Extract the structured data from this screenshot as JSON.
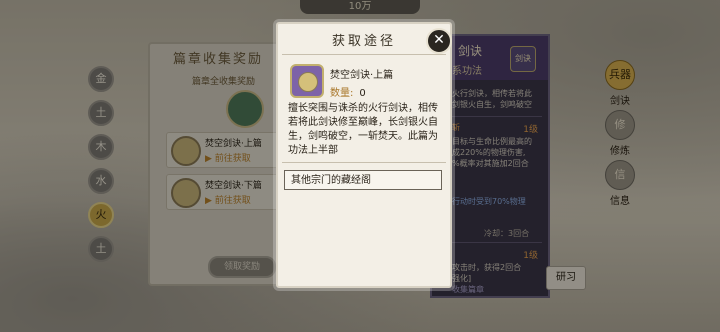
{
  "topbar": {
    "value": "10万"
  },
  "elements": {
    "items": [
      "金",
      "土",
      "木",
      "水",
      "火",
      "土"
    ]
  },
  "left_panel": {
    "title": "篇章收集奖励",
    "reward_label": "篇章全收集奖励",
    "books": [
      {
        "name": "焚空剑诀·上篇",
        "link": "前往获取"
      },
      {
        "name": "焚空剑诀·下篇",
        "link": "前往获取"
      }
    ],
    "claim_button": "领取奖励"
  },
  "modal": {
    "title": "获取途径",
    "item_name": "焚空剑诀·上篇",
    "qty_label": "数量:",
    "qty_value": "0",
    "description": "擅长突围与诛杀的火行剑诀，相传若将此剑诀修至巅峰，长剑银火自生，剑鸣破空，一斩焚天。此篇为功法上半部",
    "source": "其他宗门的藏经阁"
  },
  "right_panel": {
    "title": "剑诀",
    "subtitle": "系功法",
    "skill_icon": "剑诀",
    "line1": "火行剑诀，相传若将此",
    "line2": "剑银火自生，剑鸣破空",
    "row1_label": "斩",
    "row1_level": "1级",
    "line3": "目标与生命比例最高的",
    "line4": "成220%的物理伤害,",
    "line5": "%概率对其施加2回合",
    "line6": "行动时受到70%物理",
    "cooldown": "冷却：3回合",
    "row2_level": "1级",
    "line7": "攻击时，获得2回合",
    "line8": "强化]",
    "footer": "收集篇章"
  },
  "research_button": "研习",
  "sidenav": [
    {
      "label": "剑诀",
      "icon": "兵器"
    },
    {
      "label": "修炼",
      "icon": "修"
    },
    {
      "label": "信息",
      "icon": "信"
    }
  ]
}
